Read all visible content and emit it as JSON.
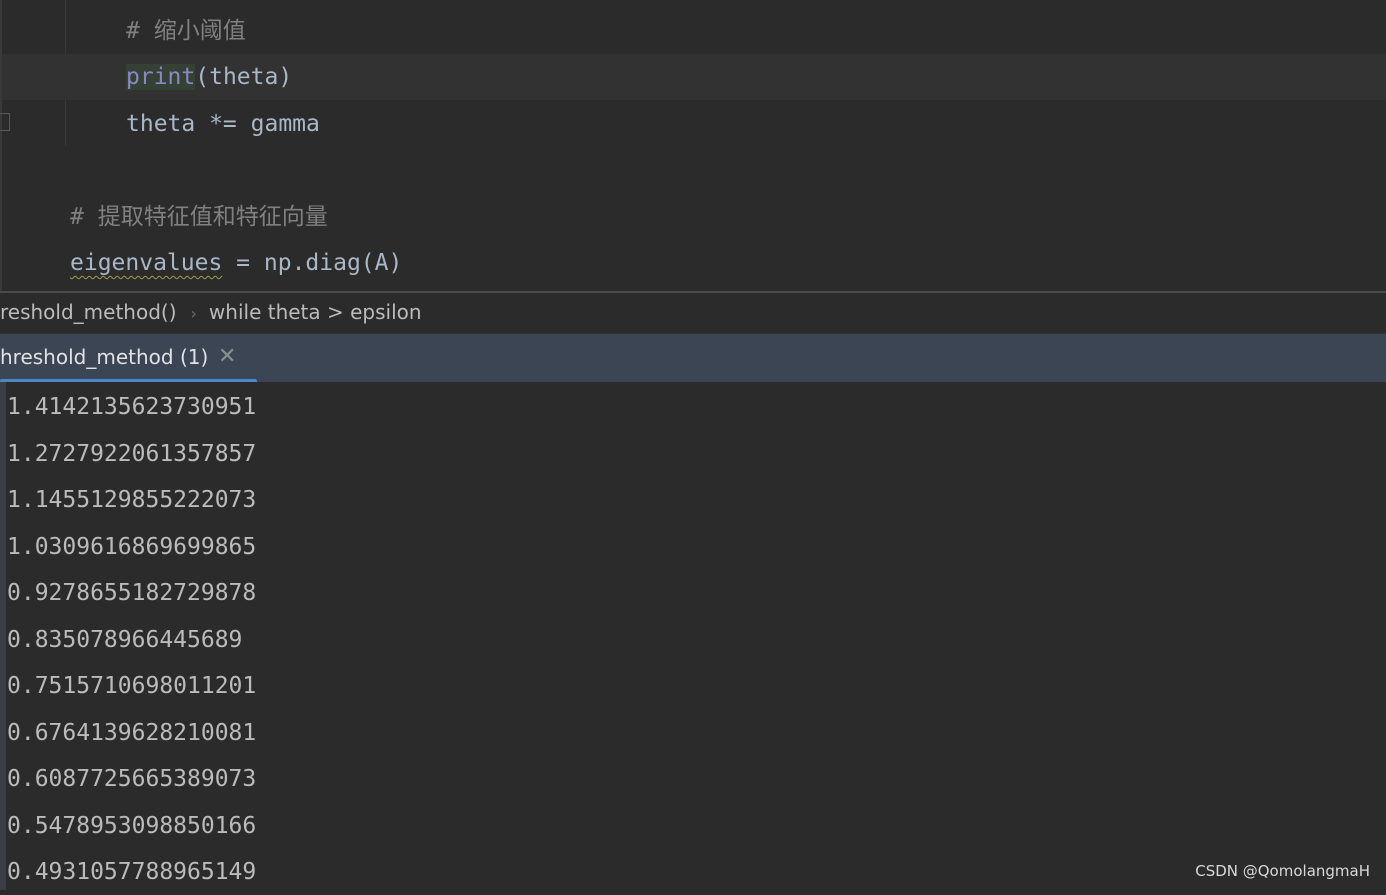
{
  "editor": {
    "lines": [
      {
        "comment": "# 缩小阈值"
      },
      {
        "keyword": "print",
        "rest": "(theta)"
      },
      {
        "text": "theta *= gamma"
      },
      {
        "comment": "# 提取特征值和特征向量"
      },
      {
        "warned": "eigenvalues",
        "rest": " = np.diag(A)"
      }
    ]
  },
  "breadcrumb": {
    "items": [
      "reshold_method()",
      "while theta > epsilon"
    ],
    "separator": "›"
  },
  "run_tab": {
    "label": "hreshold_method (1)",
    "close": "✕"
  },
  "console": {
    "output": [
      "1.4142135623730951",
      "1.2727922061357857",
      "1.1455129855222073",
      "1.0309616869699865",
      "0.9278655182729878",
      "0.835078966445689",
      "0.7515710698011201",
      "0.6764139628210081",
      "0.6087725665389073",
      "0.5478953098850166",
      "0.4931057788965149"
    ]
  },
  "watermark": "CSDN @QomolangmaH",
  "colors": {
    "accent": "#4a88c7",
    "keyword": "#8888c6",
    "comment": "#808080",
    "background": "#2b2b2b"
  }
}
